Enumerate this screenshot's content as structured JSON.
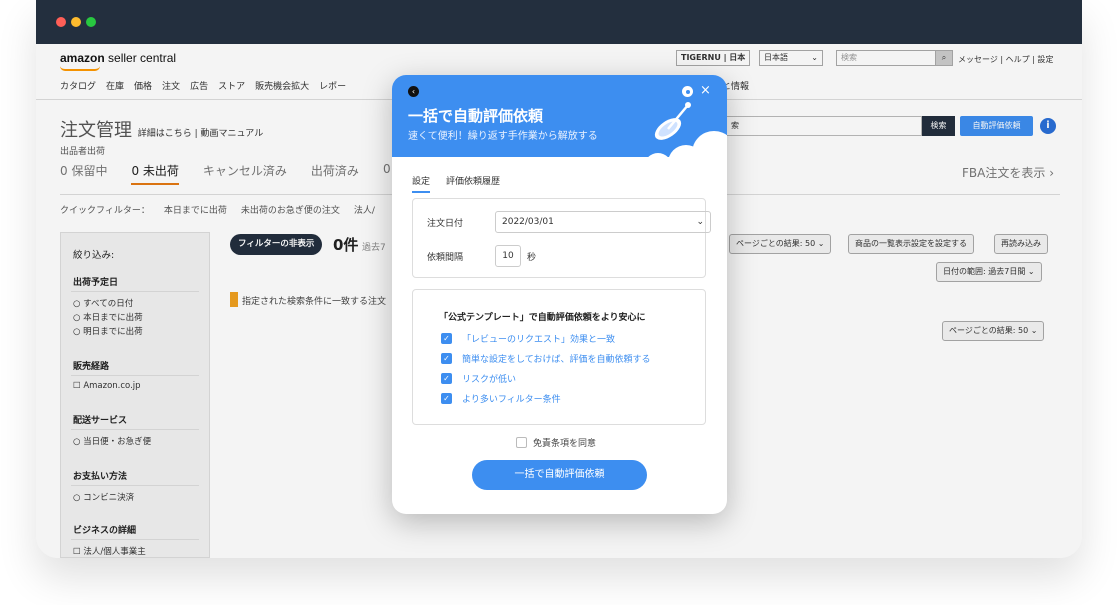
{
  "window": {
    "dots": [
      "#ff5f57",
      "#febc2e",
      "#28c840"
    ]
  },
  "seller_central": {
    "logo_brand": "amazon",
    "logo_text": "seller central",
    "menu": [
      "カタログ",
      "在庫",
      "価格",
      "注文",
      "広告",
      "ストア",
      "販売機会拡大",
      "レポー"
    ],
    "menu_tail": "と情報",
    "store": "TIGERNU | 日本",
    "language": "日本語",
    "search_placeholder": "検索",
    "top_links": "メッセージ | ヘルプ | 設定",
    "page_title": "注文管理",
    "title_links": "詳細はこちら | 動画マニュアル",
    "seller_label": "出品者出荷",
    "tabs": [
      {
        "label": "0 保留中",
        "active": false
      },
      {
        "label": "0 未出荷",
        "active": true
      },
      {
        "label": "キャンセル済み",
        "active": false
      },
      {
        "label": "出荷済み",
        "active": false
      },
      {
        "label": "0",
        "active": false
      }
    ],
    "fba_link": "FBA注文を表示",
    "quick_filters": [
      "クイックフィルター：",
      "本日までに出荷",
      "未出荷のお急ぎ便の注文",
      "法人/"
    ],
    "filter_heading": "絞り込み:",
    "sidebar": {
      "ship_date": {
        "title": "出荷予定日",
        "items": [
          "すべての日付",
          "本日までに出荷",
          "明日までに出荷"
        ]
      },
      "channel": {
        "title": "販売経路",
        "items": [
          "Amazon.co.jp"
        ]
      },
      "delivery": {
        "title": "配送サービス",
        "items": [
          "当日便・お急ぎ便"
        ]
      },
      "payment": {
        "title": "お支払い方法",
        "items": [
          "コンビニ決済"
        ]
      },
      "business": {
        "title": "ビジネスの詳細",
        "items": [
          "法人/個人事業主"
        ]
      }
    },
    "hide_filter_button": "フィルターの非表示",
    "count": "0件",
    "count_sub": "過去7",
    "empty_notice": "指定された検索条件に一致する注文",
    "search_button": "検索",
    "search_input_tail": "索",
    "auto_review_button": "自動評価依頼",
    "per_page": "ページごとの結果: 50",
    "bulk_settings": "商品の一覧表示設定を設定する",
    "reload": "再読み込み",
    "date_range": "日付の範囲: 過去7日間"
  },
  "modal": {
    "title": "一括で自動評価依頼",
    "subtitle": "速くて便利！繰り返す手作業から解放する",
    "tabs": [
      {
        "label": "設定",
        "active": true
      },
      {
        "label": "評価依頼履歴",
        "active": false
      }
    ],
    "order_date_label": "注文日付",
    "order_date_value": "2022/03/01",
    "interval_label": "依頼間隔",
    "interval_value": "10",
    "interval_unit": "秒",
    "template_heading": "「公式テンプレート」で自動評価依頼をより安心に",
    "benefits": [
      "「レビューのリクエスト」効果と一致",
      "簡単な設定をしておけば、評価を自動依頼する",
      "リスクが低い",
      "より多いフィルター条件"
    ],
    "agree_label": "免責条項を同意",
    "submit": "一括で自動評価依頼"
  }
}
